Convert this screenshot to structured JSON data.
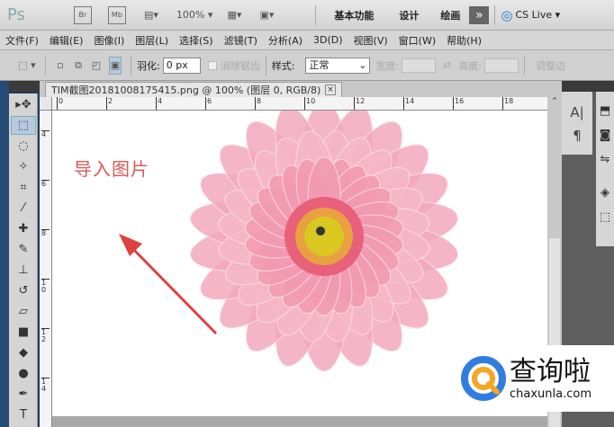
{
  "app": {
    "logo": "Ps",
    "items": [
      "Br",
      "Mb"
    ],
    "zoom": "100%",
    "workspaces": [
      "基本功能",
      "设计",
      "绘画"
    ],
    "more": "»",
    "cslive": "CS Live"
  },
  "menu": [
    "文件(F)",
    "编辑(E)",
    "图像(I)",
    "图层(L)",
    "选择(S)",
    "滤镜(T)",
    "分析(A)",
    "3D(D)",
    "视图(V)",
    "窗口(W)",
    "帮助(H)"
  ],
  "options": {
    "feather_label": "羽化:",
    "feather_value": "0 px",
    "antialias_label": "消除锯齿",
    "style_label": "样式:",
    "style_value": "正常",
    "width_label": "宽度:",
    "height_label": "高度:",
    "refine_label": "调整边"
  },
  "document": {
    "tab_title": "TIM截图20181008175415.png @ 100% (图层 0, RGB/8)",
    "close": "×"
  },
  "rulers": {
    "h": [
      "0",
      "2",
      "4",
      "6",
      "8",
      "10",
      "12",
      "14",
      "16",
      "18"
    ],
    "v": [
      "4",
      "6",
      "8",
      "10",
      "12",
      "14"
    ]
  },
  "image": {
    "annotation": "导入图片",
    "accent": "#e04040"
  },
  "tools": [
    "move-icon",
    "rect-marquee-icon",
    "lasso-icon",
    "magic-wand-icon",
    "crop-icon",
    "eyedropper-icon",
    "healing-icon",
    "brush-icon",
    "stamp-icon",
    "history-brush-icon",
    "eraser-icon",
    "gradient-icon",
    "blur-icon",
    "dodge-icon",
    "pen-icon",
    "type-icon"
  ],
  "panels": {
    "char": "A|",
    "para": "¶"
  },
  "watermark": {
    "name": "查询啦",
    "url": "chaxunla.com"
  }
}
